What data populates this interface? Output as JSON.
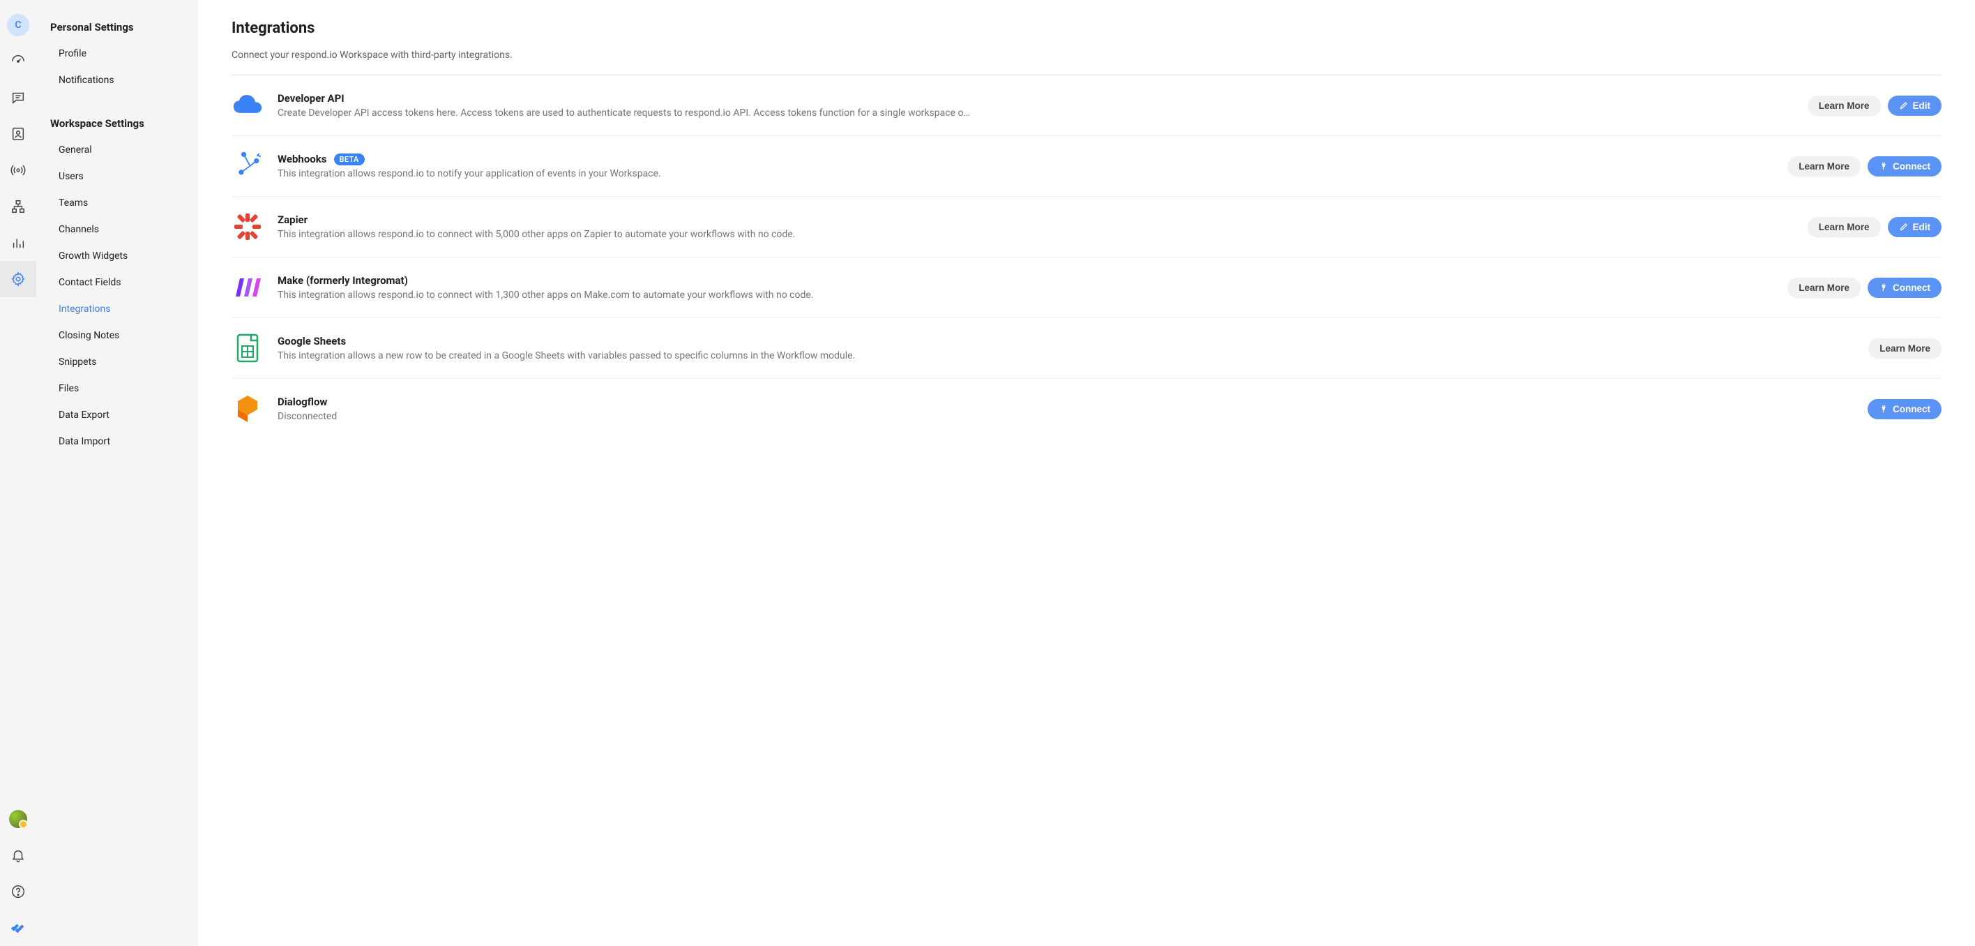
{
  "rail": {
    "avatar_letter": "C"
  },
  "sidebar": {
    "personal_header": "Personal Settings",
    "personal_items": [
      "Profile",
      "Notifications"
    ],
    "workspace_header": "Workspace Settings",
    "workspace_items": [
      "General",
      "Users",
      "Teams",
      "Channels",
      "Growth Widgets",
      "Contact Fields",
      "Integrations",
      "Closing Notes",
      "Snippets",
      "Files",
      "Data Export",
      "Data Import"
    ],
    "active": "Integrations"
  },
  "page": {
    "title": "Integrations",
    "subtitle": "Connect your respond.io Workspace with third-party integrations."
  },
  "buttons": {
    "learn_more": "Learn More",
    "edit": "Edit",
    "connect": "Connect"
  },
  "badges": {
    "beta": "BETA"
  },
  "integrations": [
    {
      "id": "developer-api",
      "title": "Developer API",
      "desc": "Create Developer API access tokens here. Access tokens are used to authenticate requests to respond.io API. Access tokens function for a single workspace o…",
      "actions": [
        "learn_more",
        "edit"
      ]
    },
    {
      "id": "webhooks",
      "title": "Webhooks",
      "beta": true,
      "desc": "This integration allows respond.io to notify your application of events in your Workspace.",
      "actions": [
        "learn_more",
        "connect"
      ]
    },
    {
      "id": "zapier",
      "title": "Zapier",
      "desc": "This integration allows respond.io to connect with 5,000 other apps on Zapier to automate your workflows with no code.",
      "actions": [
        "learn_more",
        "edit"
      ]
    },
    {
      "id": "make",
      "title": "Make (formerly Integromat)",
      "desc": "This integration allows respond.io to connect with 1,300 other apps on Make.com to automate your workflows with no code.",
      "actions": [
        "learn_more",
        "connect"
      ]
    },
    {
      "id": "google-sheets",
      "title": "Google Sheets",
      "desc": "This integration allows a new row to be created in a Google Sheets with variables passed to specific columns in the Workflow module.",
      "actions": [
        "learn_more"
      ]
    },
    {
      "id": "dialogflow",
      "title": "Dialogflow",
      "desc": "Disconnected",
      "actions": [
        "connect"
      ]
    }
  ]
}
